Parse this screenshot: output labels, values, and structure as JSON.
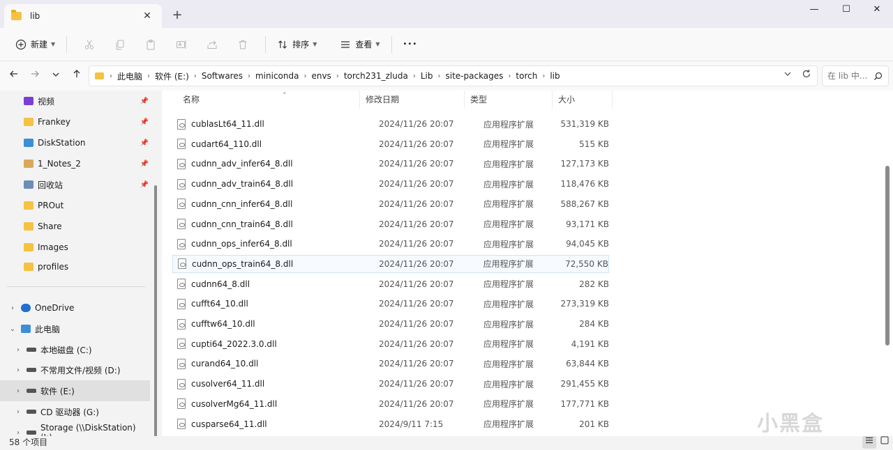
{
  "window": {
    "tab_title": "lib",
    "close_tab_glyph": "✕",
    "new_tab_glyph": "+",
    "minimize_glyph": "—",
    "maximize_glyph": "☐",
    "close_glyph": "✕"
  },
  "toolbar": {
    "new_label": "新建",
    "sort_label": "排序",
    "view_label": "查看",
    "more_glyph": "•••"
  },
  "address": {
    "crumbs": [
      "此电脑",
      "软件 (E:)",
      "Softwares",
      "miniconda",
      "envs",
      "torch231_zluda",
      "Lib",
      "site-packages",
      "torch",
      "lib"
    ],
    "search_placeholder": "在 lib 中..."
  },
  "sidebar": {
    "quick": [
      {
        "label": "视频",
        "icon": "video-folder-icon",
        "color": "#7a3fd1"
      },
      {
        "label": "Frankey",
        "icon": "folder-icon",
        "color": "#f5c242"
      },
      {
        "label": "DiskStation",
        "icon": "monitor-icon",
        "color": "#3a8fd6"
      },
      {
        "label": "1_Notes_2",
        "icon": "image-folder-icon",
        "color": "#d9a85a"
      },
      {
        "label": "回收站",
        "icon": "recycle-bin-icon",
        "color": "#6e8fb5"
      },
      {
        "label": "PROut",
        "icon": "folder-icon",
        "color": "#f5c242"
      },
      {
        "label": "Share",
        "icon": "folder-icon",
        "color": "#f5c242"
      },
      {
        "label": "Images",
        "icon": "folder-icon",
        "color": "#f5c242"
      },
      {
        "label": "profiles",
        "icon": "folder-icon",
        "color": "#f5c242"
      }
    ],
    "tree": [
      {
        "label": "OneDrive",
        "icon": "cloud-icon",
        "color": "#1f6fd1",
        "indent": 0
      },
      {
        "label": "此电脑",
        "icon": "computer-icon",
        "color": "#3a8fd6",
        "indent": 0
      },
      {
        "label": "本地磁盘 (C:)",
        "icon": "drive-icon",
        "color": "#555555",
        "indent": 1
      },
      {
        "label": "不常用文件/视频 (D:)",
        "icon": "drive-icon",
        "color": "#555555",
        "indent": 1
      },
      {
        "label": "软件 (E:)",
        "icon": "drive-icon",
        "color": "#555555",
        "indent": 1
      },
      {
        "label": "CD 驱动器 (G:)",
        "icon": "cd-drive-icon",
        "color": "#555555",
        "indent": 1
      },
      {
        "label": "Storage (\\\\DiskStation) (I:)",
        "icon": "network-drive-icon",
        "color": "#555555",
        "indent": 1
      }
    ]
  },
  "columns": {
    "name": "名称",
    "date": "修改日期",
    "type": "类型",
    "size": "大小"
  },
  "files": [
    {
      "name": "cublasLt64_11.dll",
      "date": "2024/11/26 20:07",
      "type": "应用程序扩展",
      "size": "531,319 KB"
    },
    {
      "name": "cudart64_110.dll",
      "date": "2024/11/26 20:07",
      "type": "应用程序扩展",
      "size": "515 KB"
    },
    {
      "name": "cudnn_adv_infer64_8.dll",
      "date": "2024/11/26 20:07",
      "type": "应用程序扩展",
      "size": "127,173 KB"
    },
    {
      "name": "cudnn_adv_train64_8.dll",
      "date": "2024/11/26 20:07",
      "type": "应用程序扩展",
      "size": "118,476 KB"
    },
    {
      "name": "cudnn_cnn_infer64_8.dll",
      "date": "2024/11/26 20:07",
      "type": "应用程序扩展",
      "size": "588,267 KB"
    },
    {
      "name": "cudnn_cnn_train64_8.dll",
      "date": "2024/11/26 20:07",
      "type": "应用程序扩展",
      "size": "93,171 KB"
    },
    {
      "name": "cudnn_ops_infer64_8.dll",
      "date": "2024/11/26 20:07",
      "type": "应用程序扩展",
      "size": "94,045 KB"
    },
    {
      "name": "cudnn_ops_train64_8.dll",
      "date": "2024/11/26 20:07",
      "type": "应用程序扩展",
      "size": "72,550 KB"
    },
    {
      "name": "cudnn64_8.dll",
      "date": "2024/11/26 20:07",
      "type": "应用程序扩展",
      "size": "282 KB"
    },
    {
      "name": "cufft64_10.dll",
      "date": "2024/11/26 20:07",
      "type": "应用程序扩展",
      "size": "273,319 KB"
    },
    {
      "name": "cufftw64_10.dll",
      "date": "2024/11/26 20:07",
      "type": "应用程序扩展",
      "size": "284 KB"
    },
    {
      "name": "cupti64_2022.3.0.dll",
      "date": "2024/11/26 20:07",
      "type": "应用程序扩展",
      "size": "4,191 KB"
    },
    {
      "name": "curand64_10.dll",
      "date": "2024/11/26 20:07",
      "type": "应用程序扩展",
      "size": "63,844 KB"
    },
    {
      "name": "cusolver64_11.dll",
      "date": "2024/11/26 20:07",
      "type": "应用程序扩展",
      "size": "291,455 KB"
    },
    {
      "name": "cusolverMg64_11.dll",
      "date": "2024/11/26 20:07",
      "type": "应用程序扩展",
      "size": "177,771 KB"
    },
    {
      "name": "cusparse64_11.dll",
      "date": "2024/9/11 7:15",
      "type": "应用程序扩展",
      "size": "201 KB"
    }
  ],
  "status": {
    "item_count": "58 个项目"
  },
  "watermark": "小黑盒"
}
